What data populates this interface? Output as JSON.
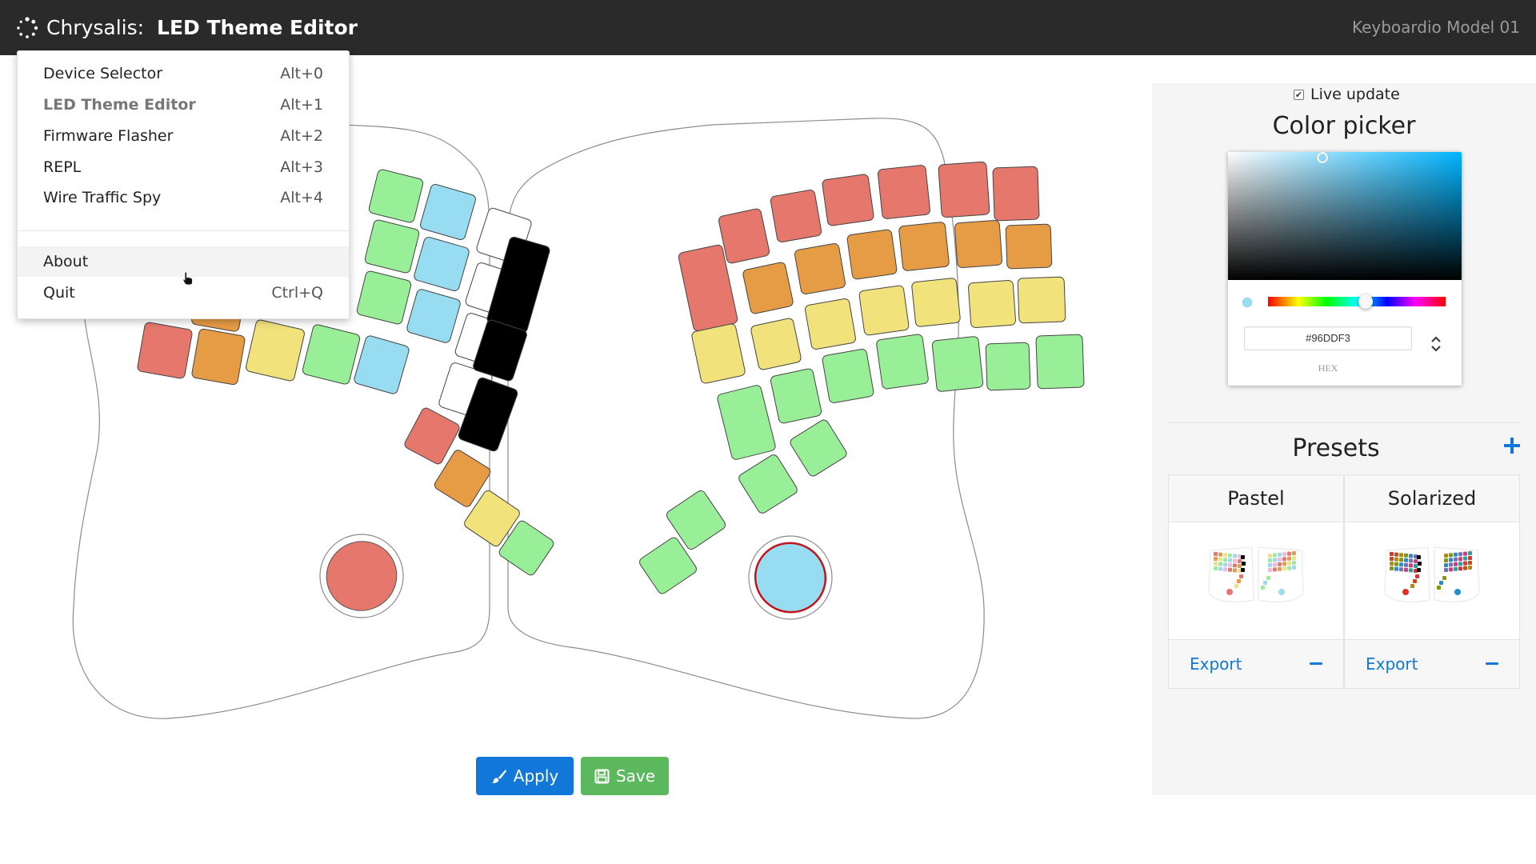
{
  "header": {
    "app_name": "Chrysalis:",
    "page_name": "LED Theme Editor",
    "device": "Keyboardio Model 01"
  },
  "menu": {
    "items": [
      {
        "label": "Device Selector",
        "shortcut": "Alt+0"
      },
      {
        "label": "LED Theme Editor",
        "shortcut": "Alt+1"
      },
      {
        "label": "Firmware Flasher",
        "shortcut": "Alt+2"
      },
      {
        "label": "REPL",
        "shortcut": "Alt+3"
      },
      {
        "label": "Wire Traffic Spy",
        "shortcut": "Alt+4"
      },
      {
        "label": "About",
        "shortcut": ""
      },
      {
        "label": "Quit",
        "shortcut": "Ctrl+Q"
      }
    ]
  },
  "actions": {
    "apply_label": "Apply",
    "save_label": "Save",
    "apply_color": "#1177d8",
    "save_color": "#5cb85c"
  },
  "color_picker": {
    "live_update_label": "Live update",
    "live_update_checked": true,
    "title": "Color picker",
    "hex_value": "#96DDF3",
    "format_label": "HEX"
  },
  "presets": {
    "title": "Presets",
    "items": [
      {
        "name": "Pastel",
        "export_label": "Export"
      },
      {
        "name": "Solarized",
        "export_label": "Export"
      }
    ]
  },
  "keyboard": {
    "palette": {
      "red": "#e5776d",
      "orange": "#e69b45",
      "yellow": "#f2e27c",
      "green": "#99ef98",
      "blue": "#98dcf2",
      "white": "#ffffff",
      "black": "#000000"
    },
    "left_palm_key": "red",
    "right_palm_key": "blue"
  }
}
